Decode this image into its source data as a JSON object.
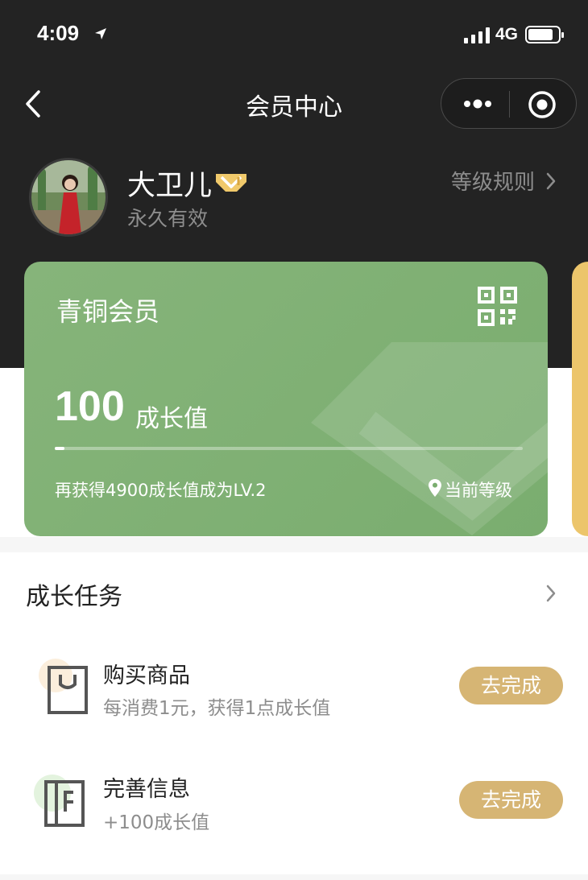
{
  "status_bar": {
    "time": "4:09",
    "network": "4G"
  },
  "nav": {
    "title": "会员中心"
  },
  "profile": {
    "name": "大卫儿",
    "validity": "永久有效",
    "rules_link": "等级规则"
  },
  "card": {
    "level_name": "青铜会员",
    "growth_value": "100",
    "growth_unit": "成长值",
    "tip": "再获得4900成长值成为LV.2",
    "current_level_label": "当前等级",
    "progress": 0.02
  },
  "tasks": {
    "title": "成长任务",
    "items": [
      {
        "name": "购买商品",
        "desc": "每消费1元，获得1点成长值",
        "button": "去完成",
        "icon": "shopping-bag-icon"
      },
      {
        "name": "完善信息",
        "desc": "+100成长值",
        "button": "去完成",
        "icon": "profile-form-icon"
      }
    ]
  },
  "colors": {
    "header_bg": "#232323",
    "card_green": "#7aad6f",
    "next_card_gold": "#ecc56b",
    "button_gold": "#d6b574"
  }
}
